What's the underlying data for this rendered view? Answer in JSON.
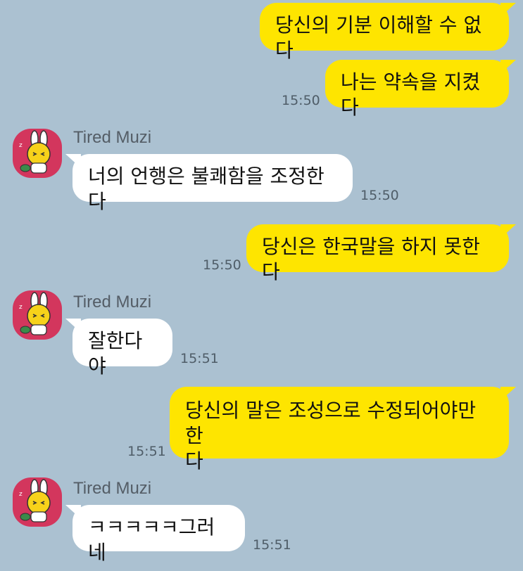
{
  "contact": {
    "name": "Tired Muzi",
    "avatar_icon": "muzi-avatar-icon"
  },
  "colors": {
    "background": "#abc1d1",
    "my_bubble": "#fee500",
    "their_bubble": "#ffffff"
  },
  "messages": [
    {
      "from": "me",
      "text": "당신의 기분 이해할 수 없다"
    },
    {
      "from": "me",
      "text": "나는 약속을 지켰다",
      "time": "15:50"
    },
    {
      "from": "them",
      "text": "너의 언행은 불쾌함을 조정한다",
      "time": "15:50"
    },
    {
      "from": "me",
      "text": "당신은 한국말을 하지 못한다",
      "time": "15:50"
    },
    {
      "from": "them",
      "text": "잘한다야",
      "time": "15:51"
    },
    {
      "from": "me",
      "text": "당신의 말은 조성으로 수정되어야만 한\n다",
      "time": "15:51"
    },
    {
      "from": "them",
      "text": "ㅋㅋㅋㅋㅋ그러네",
      "time": "15:51"
    }
  ]
}
